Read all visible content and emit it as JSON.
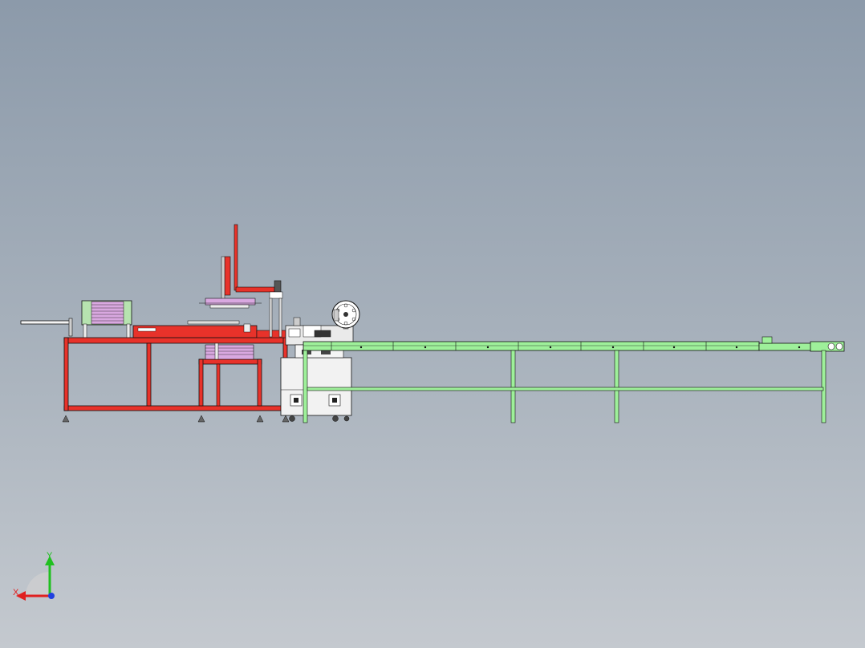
{
  "viewport": {
    "background_top": "#8c9aaa",
    "background_bottom": "#c4c9cf"
  },
  "model": {
    "frame_color": "#e8322a",
    "conveyor_color": "#9ef09a",
    "cabinet_color": "#f2f2f2",
    "stack_color": "#d9a8e0",
    "feeder_color": "#b7e3b0",
    "line_color": "#111111"
  },
  "triad": {
    "x_label": "X",
    "y_label": "Y",
    "x_color": "#e02020",
    "y_color": "#20c020",
    "z_color": "#2040e0"
  }
}
